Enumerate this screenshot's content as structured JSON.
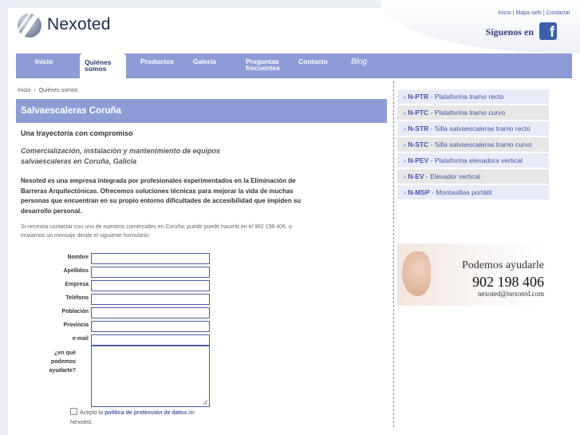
{
  "header": {
    "brand": "Nexoted",
    "toplinks": [
      "Inicio",
      "Mapa web",
      "Contactar"
    ],
    "follow_label": "Síguenos en",
    "fb_letter": "f"
  },
  "nav": {
    "items": [
      {
        "label": "Inicio"
      },
      {
        "label": "Quiénes somos"
      },
      {
        "label": "Productos"
      },
      {
        "label": "Galería"
      },
      {
        "label": "Preguntas frecuentes"
      },
      {
        "label": "Contacto"
      },
      {
        "label": "Blog"
      }
    ],
    "active_index": 1
  },
  "breadcrumb": {
    "home": "Inicio",
    "arrow": "›",
    "current": "Quiénes somos"
  },
  "main": {
    "title": "Salvaescaleras Coruña",
    "subtitle": "Una trayectoria con compromiso",
    "italic_heading": "Comercialización, instalación y mantenimiento de equipos salvaescaleras en Coruña, Galicia",
    "intro": "Nexoted es una empresa integrada por profesionales experimentados en la Eliminación de Barreras Arquitectónicas. Ofrecemos soluciones técnicas para mejorar la vida de muchas personas que encuentran en su propio entorno dificultades de accesibilidad que impiden su desarrollo personal.",
    "contact_text": "Si necesita contactar con uno de nuestros comerciales en Coruña, puede puede hacerlo en el 902 198 406, o enviarnos un mensaje desde el siguiente formulario:"
  },
  "form": {
    "fields": [
      {
        "label": "Nombre",
        "value": ""
      },
      {
        "label": "Apellidos",
        "value": ""
      },
      {
        "label": "Empresa",
        "value": ""
      },
      {
        "label": "Teléfono",
        "value": ""
      },
      {
        "label": "Población",
        "value": ""
      },
      {
        "label": "Provincia",
        "value": ""
      },
      {
        "label": "e-mail",
        "value": ""
      }
    ],
    "textarea_label": "¿en qué podemos ayudarte?",
    "privacy_prefix": "Acepto la",
    "privacy_link": "política de protección de datos",
    "privacy_suffix": "de Nexoted."
  },
  "sidebar": {
    "items": [
      {
        "code": "N-PTR",
        "text": "Plataforma tramo recto"
      },
      {
        "code": "N-PTC",
        "text": "Plataforma tramo curvo"
      },
      {
        "code": "N-STR",
        "text": "Silla salvaescaleras tramo recto"
      },
      {
        "code": "N-STC",
        "text": "Silla salvaescaleras tramo curvo"
      },
      {
        "code": "N-PEV",
        "text": "Plataforma elevadora vertical"
      },
      {
        "code": "N-EV",
        "text": "Elevador vertical"
      },
      {
        "code": "N-MSP",
        "text": "Montasillas portátil"
      }
    ],
    "dash": "-",
    "bullet": "›"
  },
  "promo": {
    "title": "Podemos ayudarle",
    "phone": "902 198 406",
    "email": "nexoted@nexoted.com"
  },
  "colors": {
    "nav": "#8e9cd6",
    "link": "#4b5aa8",
    "brand": "#1d2b4f"
  }
}
